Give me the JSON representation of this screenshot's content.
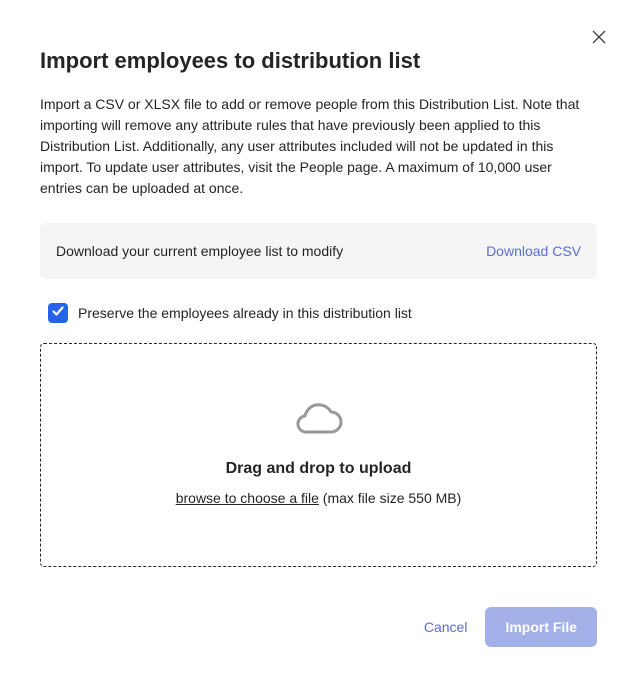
{
  "dialog": {
    "title": "Import employees to distribution list",
    "description": "Import a CSV or XLSX file to add or remove people from this Distribution List. Note that importing will remove any attribute rules that have previously been applied to this Distribution List. Additionally, any user attributes included will not be updated in this import. To update user attributes, visit the People page. A maximum of 10,000 user entries can be uploaded at once."
  },
  "download_box": {
    "text": "Download your current employee list to modify",
    "link_label": "Download CSV"
  },
  "checkbox": {
    "checked": true,
    "label": "Preserve the employees already in this distribution list"
  },
  "dropzone": {
    "title": "Drag and drop to upload",
    "browse_label": "browse to choose a file",
    "max_size_label": " (max file size 550 MB)"
  },
  "footer": {
    "cancel_label": "Cancel",
    "import_label": "Import File"
  }
}
